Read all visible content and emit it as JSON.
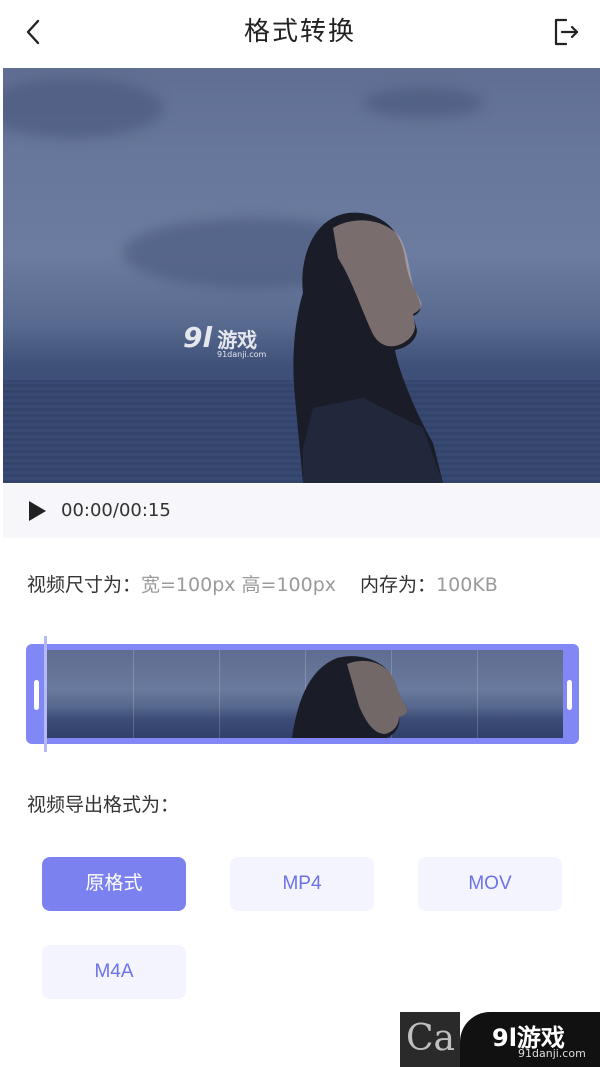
{
  "header": {
    "title": "格式转换",
    "back_icon": "chevron-left-icon",
    "export_icon": "logout-icon"
  },
  "video": {
    "watermark_num": "9l",
    "watermark_cn": "游戏",
    "watermark_domain": "91danji.com"
  },
  "player": {
    "play_icon": "play-icon",
    "time": "00:00/00:15"
  },
  "info": {
    "size_label": "视频尺寸为：",
    "size_value": "宽=100px 高=100px",
    "memory_label": "内存为：",
    "memory_value": "100KB"
  },
  "export": {
    "label": "视频导出格式为：",
    "formats": [
      "原格式",
      "MP4",
      "MOV",
      "M4A"
    ],
    "selected": "原格式"
  },
  "corner_watermark": {
    "left_text": "Ca",
    "brand": "9l游戏",
    "domain": "91danji.com"
  },
  "colors": {
    "accent": "#7b82f0",
    "accent_light": "#f3f4fe",
    "accent_text": "#6c72e6",
    "timeline": "#8187f4"
  }
}
